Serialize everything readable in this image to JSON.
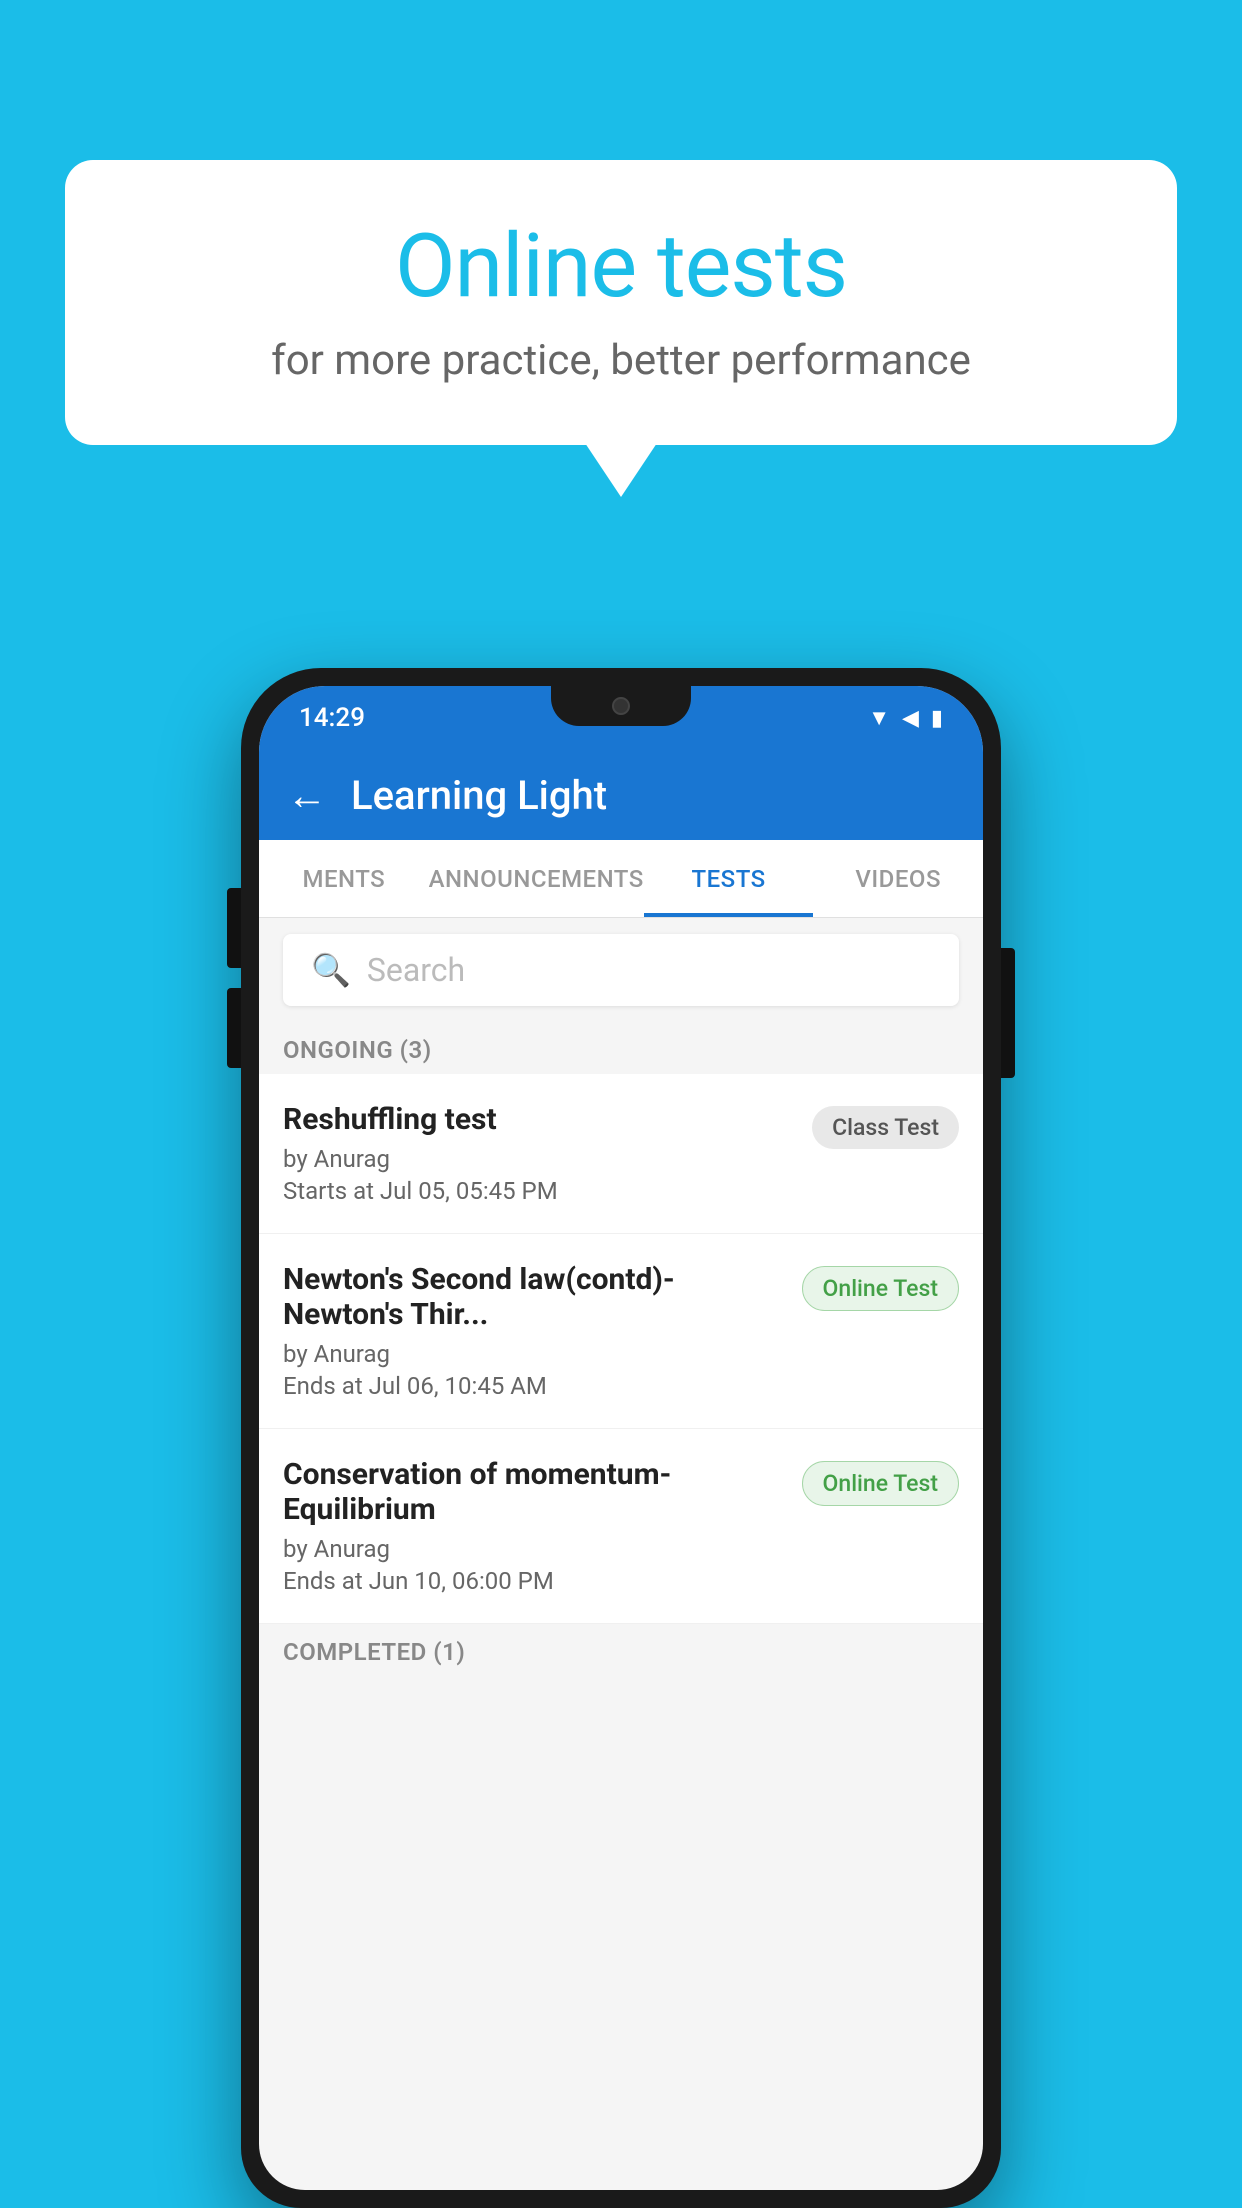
{
  "background_color": "#1BBDE8",
  "bubble": {
    "title": "Online tests",
    "subtitle": "for more practice, better performance"
  },
  "phone": {
    "status_bar": {
      "time": "14:29",
      "icons": [
        "wifi",
        "signal",
        "battery"
      ]
    },
    "header": {
      "title": "Learning Light",
      "back_label": "←"
    },
    "tabs": [
      {
        "label": "MENTS",
        "active": false
      },
      {
        "label": "ANNOUNCEMENTS",
        "active": false
      },
      {
        "label": "TESTS",
        "active": true
      },
      {
        "label": "VIDEOS",
        "active": false
      }
    ],
    "search": {
      "placeholder": "Search"
    },
    "ongoing_label": "ONGOING (3)",
    "tests": [
      {
        "name": "Reshuffling test",
        "by": "by Anurag",
        "time": "Starts at  Jul 05, 05:45 PM",
        "badge": "Class Test",
        "badge_type": "class"
      },
      {
        "name": "Newton's Second law(contd)-Newton's Thir...",
        "by": "by Anurag",
        "time": "Ends at  Jul 06, 10:45 AM",
        "badge": "Online Test",
        "badge_type": "online"
      },
      {
        "name": "Conservation of momentum-Equilibrium",
        "by": "by Anurag",
        "time": "Ends at  Jun 10, 06:00 PM",
        "badge": "Online Test",
        "badge_type": "online"
      }
    ],
    "completed_label": "COMPLETED (1)"
  }
}
